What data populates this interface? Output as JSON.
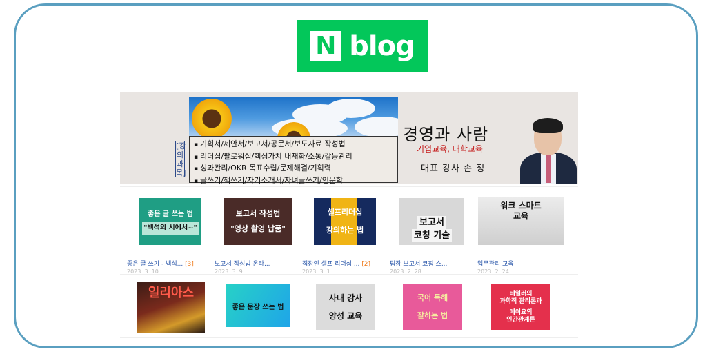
{
  "logo": {
    "mark": "N",
    "text": "blog"
  },
  "banner": {
    "vertical_label": "[강의과목]",
    "courses": [
      "기획서/제안서/보고서/공문서/보도자료 작성법",
      "리더십/팔로워십/핵심가치 내재화/소통/갈등관리",
      "성과관리/OKR 목표수립/문제해결/기획력",
      "글쓰기/책쓰기/자기소개서/자녀글쓰기/인문학"
    ],
    "title": "경영과 사람",
    "subtitle": "기업교육, 대학교육",
    "representative": "대표 강사 손 정"
  },
  "posts": [
    {
      "thumb_lines": [
        "좋은 글 쓰는 법",
        "\"백석의 시에서~\""
      ],
      "title": "좋은 글 쓰기 - 백석...",
      "count": "[3]",
      "date": "2023. 3. 10."
    },
    {
      "thumb_lines": [
        "보고서 작성법",
        "\"영상 촬영 납품\""
      ],
      "title": "보고서 작성법 온라...",
      "count": "",
      "date": "2023. 3. 9."
    },
    {
      "thumb_lines": [
        "셀프리더십",
        "강의하는 법"
      ],
      "title": "직장인 셀프 리더십 ...",
      "count": "[2]",
      "date": "2023. 3. 1."
    },
    {
      "thumb_lines": [
        "보고서",
        "코칭 기술"
      ],
      "title": "팀장 보고서 코칭 스...",
      "count": "",
      "date": "2023. 2. 28."
    },
    {
      "thumb_lines": [
        "워크 스마트",
        "교육"
      ],
      "title": "업무관리 교육",
      "count": "",
      "date": "2023. 2. 24."
    }
  ],
  "row2": [
    {
      "thumb_lines": [
        "일리아스"
      ]
    },
    {
      "thumb_lines": [
        "좋은 문장 쓰는 법"
      ]
    },
    {
      "thumb_lines": [
        "사내 강사",
        "양성 교육"
      ]
    },
    {
      "thumb_lines": [
        "국어 독해",
        "잘하는 법"
      ]
    },
    {
      "thumb_lines": [
        "테일러의",
        "과학적 관리론과",
        "",
        "메이요의",
        "인간관계론"
      ]
    }
  ],
  "colors": {
    "frame": "#5a9fc0",
    "naver_green": "#03c75a",
    "link_blue": "#2754a8",
    "count_orange": "#f07a1a",
    "accent_red": "#c41717"
  }
}
